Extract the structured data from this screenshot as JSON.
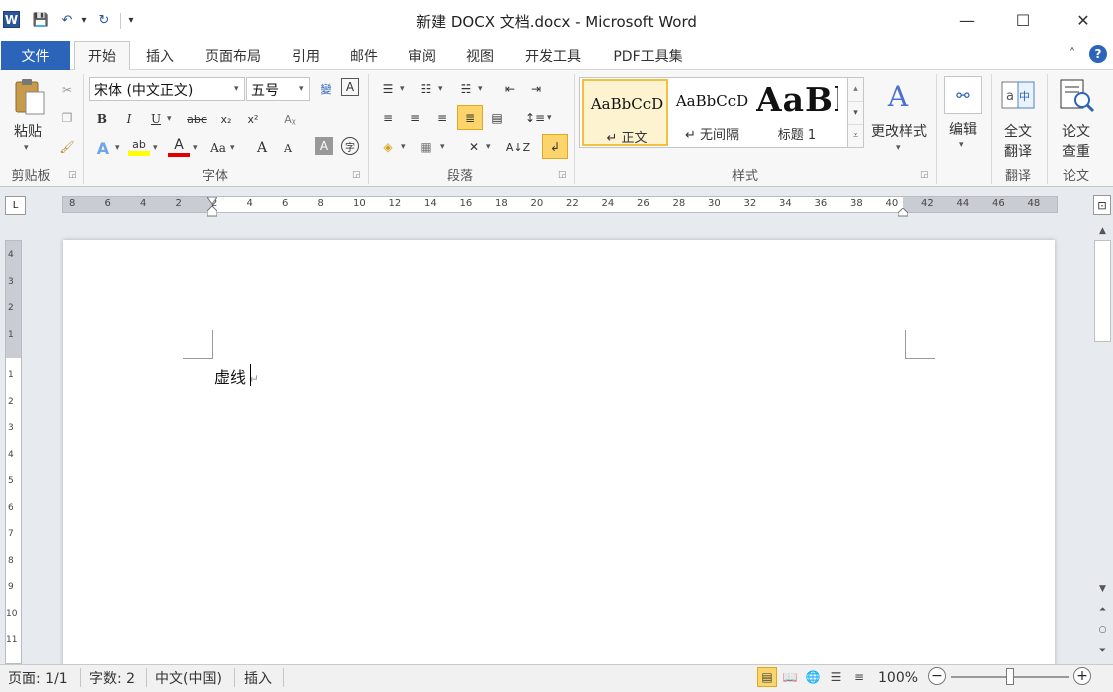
{
  "window": {
    "title": "新建 DOCX 文档.docx - Microsoft Word",
    "app_icon_letter": "W",
    "controls": {
      "minimize": "—",
      "maximize": "☐",
      "close": "✕"
    }
  },
  "quick_access": {
    "save": "💾",
    "undo": "↶",
    "undo_dd": "▾",
    "redo": "↻",
    "customize": "▾"
  },
  "tabs": [
    {
      "label": "文件"
    },
    {
      "label": "开始"
    },
    {
      "label": "插入"
    },
    {
      "label": "页面布局"
    },
    {
      "label": "引用"
    },
    {
      "label": "邮件"
    },
    {
      "label": "审阅"
    },
    {
      "label": "视图"
    },
    {
      "label": "开发工具"
    },
    {
      "label": "PDF工具集"
    }
  ],
  "tabrow_right": {
    "collapse": "˄",
    "help": "?"
  },
  "ribbon": {
    "clipboard": {
      "paste_label": "粘贴",
      "group": "剪贴板"
    },
    "font": {
      "font_name": "宋体 (中文正文)",
      "font_size": "五号",
      "bold": "B",
      "italic": "I",
      "underline": "U",
      "strike": "abc",
      "sub": "x₂",
      "sup": "x²",
      "grow": "A",
      "shrink": "A",
      "case": "Aa",
      "group": "字体"
    },
    "paragraph": {
      "group": "段落"
    },
    "styles": {
      "items": [
        {
          "sample": "AaBbCcD",
          "name": "↵ 正文"
        },
        {
          "sample": "AaBbCcD",
          "name": "↵ 无间隔"
        },
        {
          "sample": "AaBl",
          "name": "标题 1"
        }
      ],
      "change_styles": "更改样式",
      "group": "样式"
    },
    "editing": {
      "label": "编辑"
    },
    "translate": {
      "label_line1": "全文",
      "label_line2": "翻译",
      "group": "翻译"
    },
    "paper": {
      "label_line1": "论文",
      "label_line2": "查重",
      "group": "论文"
    }
  },
  "ruler": {
    "h_labels": [
      "8",
      "6",
      "4",
      "2",
      "2",
      "4",
      "6",
      "8",
      "10",
      "12",
      "14",
      "16",
      "18",
      "20",
      "22",
      "24",
      "26",
      "28",
      "30",
      "32",
      "34",
      "36",
      "38",
      "40",
      "42",
      "44",
      "46",
      "48"
    ],
    "v_labels": [
      "4",
      "3",
      "2",
      "1",
      "1",
      "2",
      "3",
      "4",
      "5",
      "6",
      "7",
      "8",
      "9",
      "10",
      "11"
    ],
    "corner": "L"
  },
  "document": {
    "text": "虚线",
    "para_mark": "↵"
  },
  "status": {
    "page": "页面: 1/1",
    "words": "字数: 2",
    "language": "中文(中国)",
    "mode": "插入",
    "zoom": "100%",
    "zoom_minus": "−",
    "zoom_plus": "+",
    "zoom_level": 0.5
  }
}
